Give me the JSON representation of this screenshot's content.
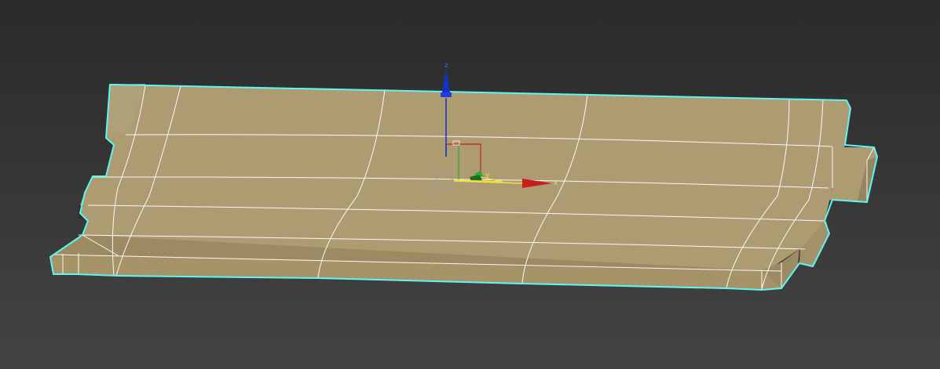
{
  "viewport": {
    "name": "3d-viewport"
  },
  "gizmo": {
    "z_label": "z",
    "y_label": "y",
    "x_label": "x"
  },
  "colors": {
    "background_top": "#2a2a2a",
    "background_bottom": "#434343",
    "mesh_top_face": "#ad9b72",
    "mesh_front_face": "#9a8a62",
    "mesh_side_face": "#8c7d58",
    "mesh_dark_face": "#3a3a32",
    "wireframe": "#ffffff",
    "selection_outline": "#5ff5f5",
    "axis_x": "#c81e1e",
    "axis_y": "#2ea82e",
    "axis_z": "#1432c8",
    "gizmo_plane": "#f0e040"
  }
}
